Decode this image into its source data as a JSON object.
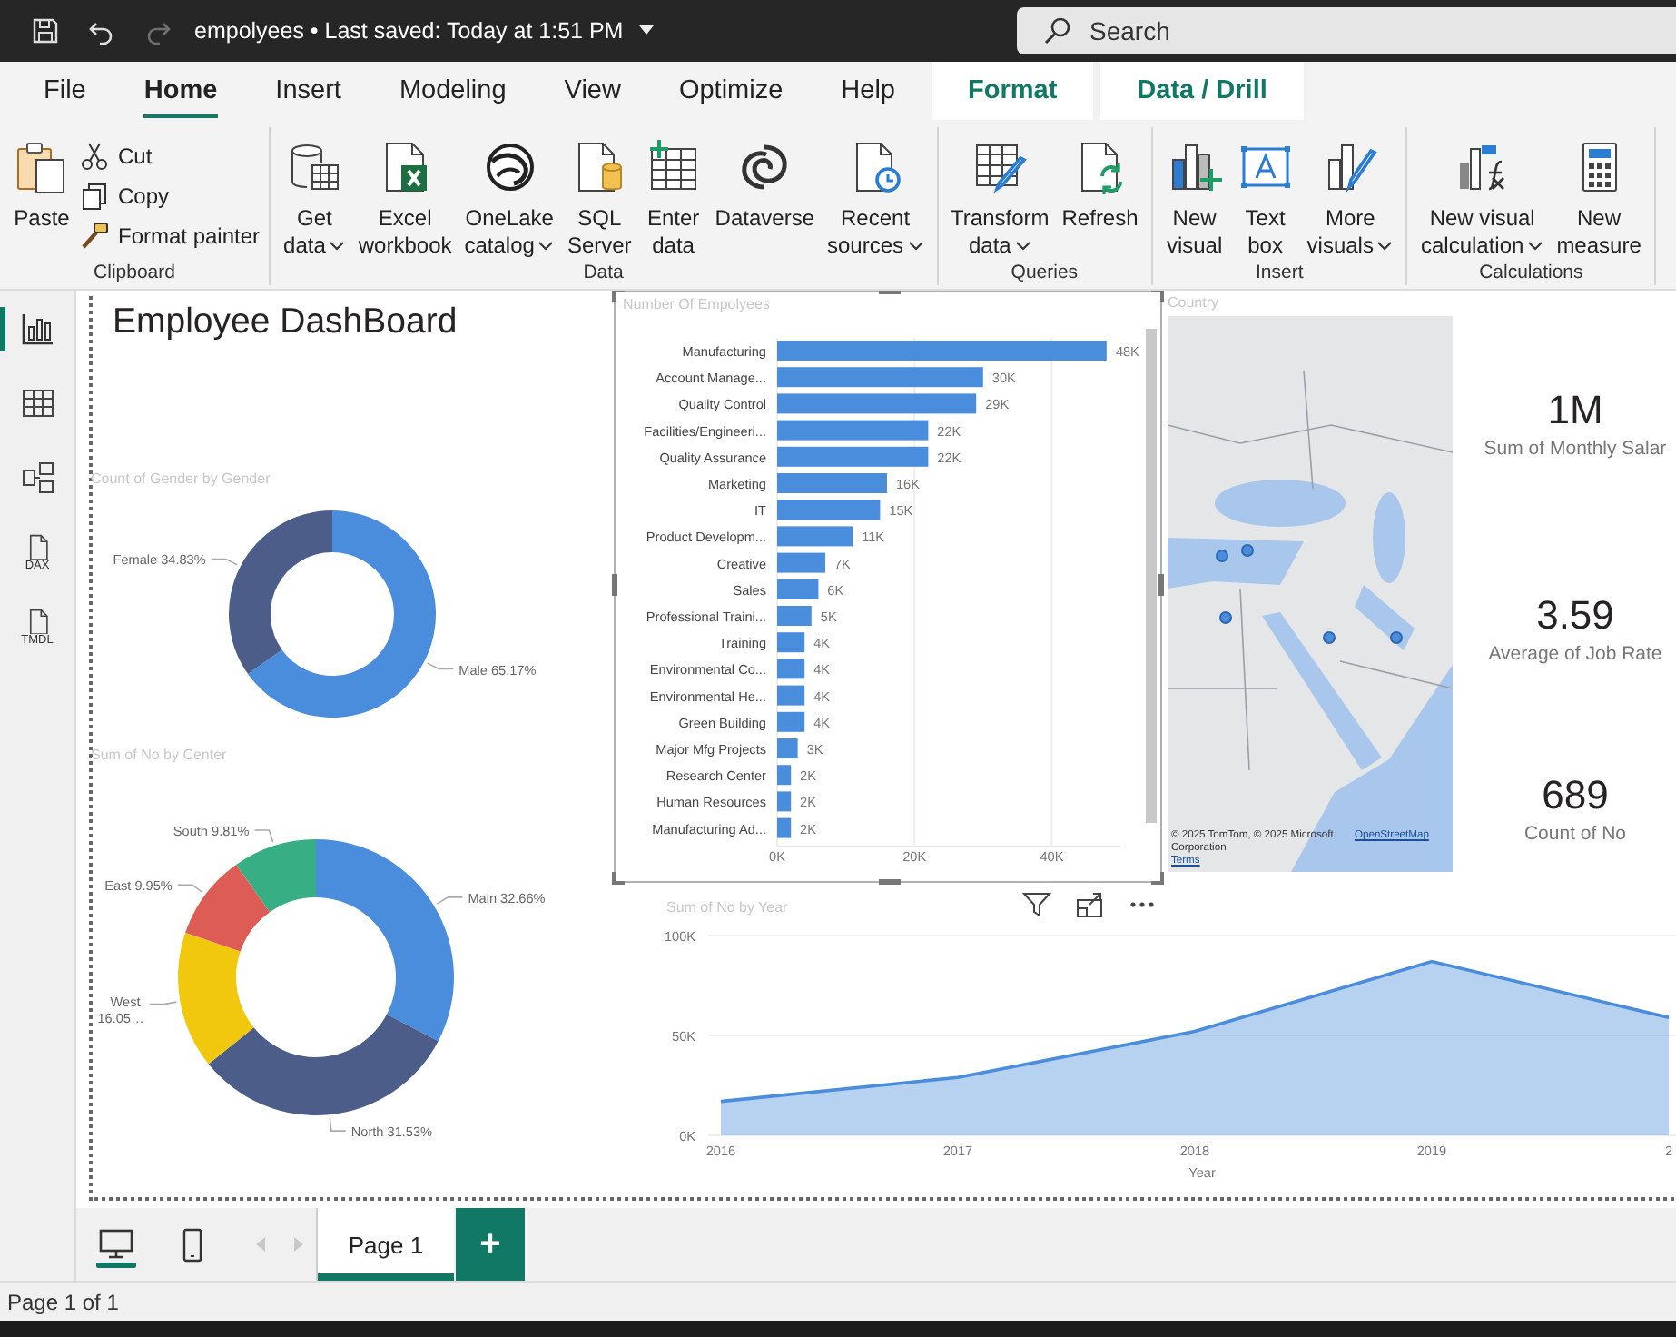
{
  "title_bar": {
    "quick_access": [
      {
        "kind": "save",
        "disabled": false
      },
      {
        "kind": "undo",
        "disabled": false
      },
      {
        "kind": "redo",
        "disabled": true
      }
    ],
    "title": "empolyees • Last saved: Today at 1:51 PM",
    "search": {
      "placeholder": "Search"
    }
  },
  "menu_tabs": [
    {
      "label": "File",
      "selected": false,
      "kind": "plain"
    },
    {
      "label": "Home",
      "selected": true,
      "kind": "plain"
    },
    {
      "label": "Insert",
      "selected": false,
      "kind": "plain"
    },
    {
      "label": "Modeling",
      "selected": false,
      "kind": "plain"
    },
    {
      "label": "View",
      "selected": false,
      "kind": "plain"
    },
    {
      "label": "Optimize",
      "selected": false,
      "kind": "plain"
    },
    {
      "label": "Help",
      "selected": false,
      "kind": "plain"
    },
    {
      "label": "Format",
      "selected": false,
      "kind": "contextual"
    },
    {
      "label": "Data / Drill",
      "selected": false,
      "kind": "contextual"
    }
  ],
  "ribbon": [
    {
      "label": "Clipboard",
      "buttons": [
        {
          "kind": "paste",
          "lines": [
            "Paste"
          ],
          "dropdown": false
        }
      ],
      "small_buttons": [
        {
          "kind": "cut",
          "lines": [
            "Cut"
          ],
          "dropdown": false
        },
        {
          "kind": "copy",
          "lines": [
            "Copy"
          ],
          "dropdown": false
        },
        {
          "kind": "format_painter",
          "lines": [
            "Format painter"
          ],
          "dropdown": false
        }
      ]
    },
    {
      "label": "Data",
      "buttons": [
        {
          "kind": "get_data",
          "lines": [
            "Get",
            "data"
          ],
          "dropdown": true
        },
        {
          "kind": "excel",
          "lines": [
            "Excel",
            "workbook"
          ],
          "dropdown": false
        },
        {
          "kind": "onelake",
          "lines": [
            "OneLake",
            "catalog"
          ],
          "dropdown": true
        },
        {
          "kind": "sql",
          "lines": [
            "SQL",
            "Server"
          ],
          "dropdown": false
        },
        {
          "kind": "enter_data",
          "lines": [
            "Enter",
            "data"
          ],
          "dropdown": false
        },
        {
          "kind": "dataverse",
          "lines": [
            "Dataverse"
          ],
          "dropdown": false
        },
        {
          "kind": "recent",
          "lines": [
            "Recent",
            "sources"
          ],
          "dropdown": true
        }
      ]
    },
    {
      "label": "Queries",
      "buttons": [
        {
          "kind": "transform",
          "lines": [
            "Transform",
            "data"
          ],
          "dropdown": true
        },
        {
          "kind": "refresh",
          "lines": [
            "Refresh"
          ],
          "dropdown": false
        }
      ]
    },
    {
      "label": "Insert",
      "buttons": [
        {
          "kind": "new_visual",
          "lines": [
            "New",
            "visual"
          ],
          "dropdown": false
        },
        {
          "kind": "text_box",
          "lines": [
            "Text",
            "box"
          ],
          "dropdown": false
        },
        {
          "kind": "more_visuals",
          "lines": [
            "More",
            "visuals"
          ],
          "dropdown": true
        }
      ]
    },
    {
      "label": "Calculations",
      "buttons": [
        {
          "kind": "visual_calc",
          "lines": [
            "New visual",
            "calculation"
          ],
          "dropdown": true
        },
        {
          "kind": "new_measure",
          "lines": [
            "New",
            "measure"
          ],
          "dropdown": false
        }
      ]
    }
  ],
  "nav": [
    {
      "kind": "report",
      "selected": true
    },
    {
      "kind": "table",
      "selected": false
    },
    {
      "kind": "model",
      "selected": false
    },
    {
      "kind": "dax",
      "label": "DAX",
      "selected": false
    },
    {
      "kind": "tmdl",
      "label": "TMDL",
      "selected": false
    }
  ],
  "report": {
    "title": "Employee DashBoard",
    "gender_chart": {
      "chart_data": {
        "type": "donut",
        "title": "Count of Gender by Gender",
        "categories": [
          "Male",
          "Female"
        ],
        "values": [
          65.17,
          34.83
        ],
        "colors": [
          "#4a8ddc",
          "#4c5d8a"
        ],
        "value_labels": [
          "65.17%",
          "34.83%"
        ]
      }
    },
    "center_chart": {
      "chart_data": {
        "type": "donut",
        "title": "Sum of No by Center",
        "categories": [
          "Main",
          "North",
          "West",
          "East",
          "South"
        ],
        "values": [
          32.66,
          31.53,
          16.05,
          9.95,
          9.81
        ],
        "colors": [
          "#4a8ddc",
          "#4c5d8a",
          "#f2c80f",
          "#dd5c56",
          "#37ae83"
        ],
        "value_labels": [
          "32.66%",
          "31.53%",
          "16.05…",
          "9.95%",
          "9.81%"
        ]
      }
    },
    "department_chart": {
      "selected": true,
      "chart_data": {
        "type": "bar",
        "orientation": "horizontal",
        "title": "Number Of Empolyees",
        "categories": [
          "Manufacturing",
          "Account Manage...",
          "Quality Control",
          "Facilities/Engineeri...",
          "Quality Assurance",
          "Marketing",
          "IT",
          "Product Developm...",
          "Creative",
          "Sales",
          "Professional Traini...",
          "Training",
          "Environmental Co...",
          "Environmental He...",
          "Green Building",
          "Major Mfg Projects",
          "Research Center",
          "Human Resources",
          "Manufacturing Ad..."
        ],
        "values": [
          48000,
          30000,
          29000,
          22000,
          22000,
          16000,
          15000,
          11000,
          7000,
          6000,
          5000,
          4000,
          4000,
          4000,
          4000,
          3000,
          2000,
          2000,
          2000
        ],
        "value_labels": [
          "48K",
          "30K",
          "29K",
          "22K",
          "22K",
          "16K",
          "15K",
          "11K",
          "7K",
          "6K",
          "5K",
          "4K",
          "4K",
          "4K",
          "4K",
          "3K",
          "2K",
          "2K",
          "2K"
        ],
        "xlim": [
          0,
          50000
        ],
        "xticks": [
          {
            "value": 0,
            "label": "0K"
          },
          {
            "value": 20000,
            "label": "20K"
          },
          {
            "value": 40000,
            "label": "40K"
          }
        ]
      }
    },
    "map": {
      "title": "Country",
      "attribution": "© 2025 TomTom, © 2025 Microsoft Corporation",
      "links": [
        "OpenStreetMap",
        "Terms"
      ]
    },
    "cards": [
      {
        "value": "1M",
        "label": "Sum of Monthly Salar"
      },
      {
        "value": "3.59",
        "label": "Average of Job Rate"
      },
      {
        "value": "689",
        "label": "Count of No"
      }
    ],
    "year_chart": {
      "chart_data": {
        "type": "area",
        "title": "Sum of No by Year",
        "xlabel": "Year",
        "categories": [
          "2016",
          "2017",
          "2018",
          "2019",
          "2"
        ],
        "series": [
          {
            "color": "#4a8ddc",
            "values": [
              17000,
              29000,
              52000,
              87000,
              59000
            ]
          }
        ],
        "ylim": [
          0,
          100000
        ],
        "yticks": [
          {
            "value": 0,
            "label": "0K"
          },
          {
            "value": 50000,
            "label": "50K"
          },
          {
            "value": 100000,
            "label": "100K"
          }
        ]
      }
    }
  },
  "page_bar": {
    "layouts": [
      {
        "kind": "desktop",
        "selected": true
      },
      {
        "kind": "mobile",
        "selected": false
      }
    ],
    "nav_arrows": [
      {
        "kind": "previous",
        "disabled": true
      },
      {
        "kind": "next",
        "disabled": true
      }
    ],
    "pages": [
      {
        "label": "Page 1",
        "selected": true
      }
    ],
    "add_page": "+"
  },
  "status_bar": {
    "text": "Page 1 of 1"
  }
}
